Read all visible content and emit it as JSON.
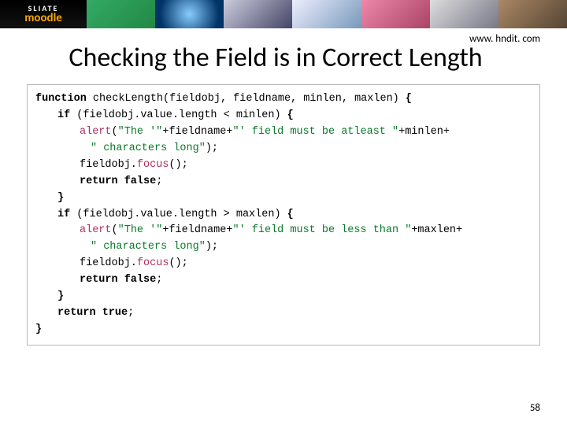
{
  "banner": {
    "logo_top": "SLIATE",
    "logo_bottom": "moodle"
  },
  "url": "www. hndit. com",
  "title": "Checking the Field is in Correct Length",
  "code": {
    "l0_a": "function",
    "l0_b": " checkLength(fieldobj, fieldname, minlen, maxlen) ",
    "l0_c": "{",
    "l1_a": "if",
    "l1_b": " (fieldobj.value.length < minlen) ",
    "l1_c": "{",
    "l2_a": "alert",
    "l2_b": "(",
    "l2_c": "\"The '\"",
    "l2_d": "+fieldname+",
    "l2_e": "\"' field must be atleast \"",
    "l2_f": "+minlen+",
    "l3_a": "\" characters long\"",
    "l3_b": ");",
    "l4_a": "fieldobj.",
    "l4_b": "focus",
    "l4_c": "();",
    "l5_a": "return false",
    "l5_b": ";",
    "l6_a": "}",
    "l7_a": "if",
    "l7_b": " (fieldobj.value.length > maxlen) ",
    "l7_c": "{",
    "l8_a": "alert",
    "l8_b": "(",
    "l8_c": "\"The '\"",
    "l8_d": "+fieldname+",
    "l8_e": "\"' field must be less than \"",
    "l8_f": "+maxlen+",
    "l9_a": "\" characters long\"",
    "l9_b": ");",
    "l10_a": "fieldobj.",
    "l10_b": "focus",
    "l10_c": "();",
    "l11_a": "return false",
    "l11_b": ";",
    "l12_a": "}",
    "l13_a": "return true",
    "l13_b": ";",
    "l14_a": "}"
  },
  "page_number": "58"
}
